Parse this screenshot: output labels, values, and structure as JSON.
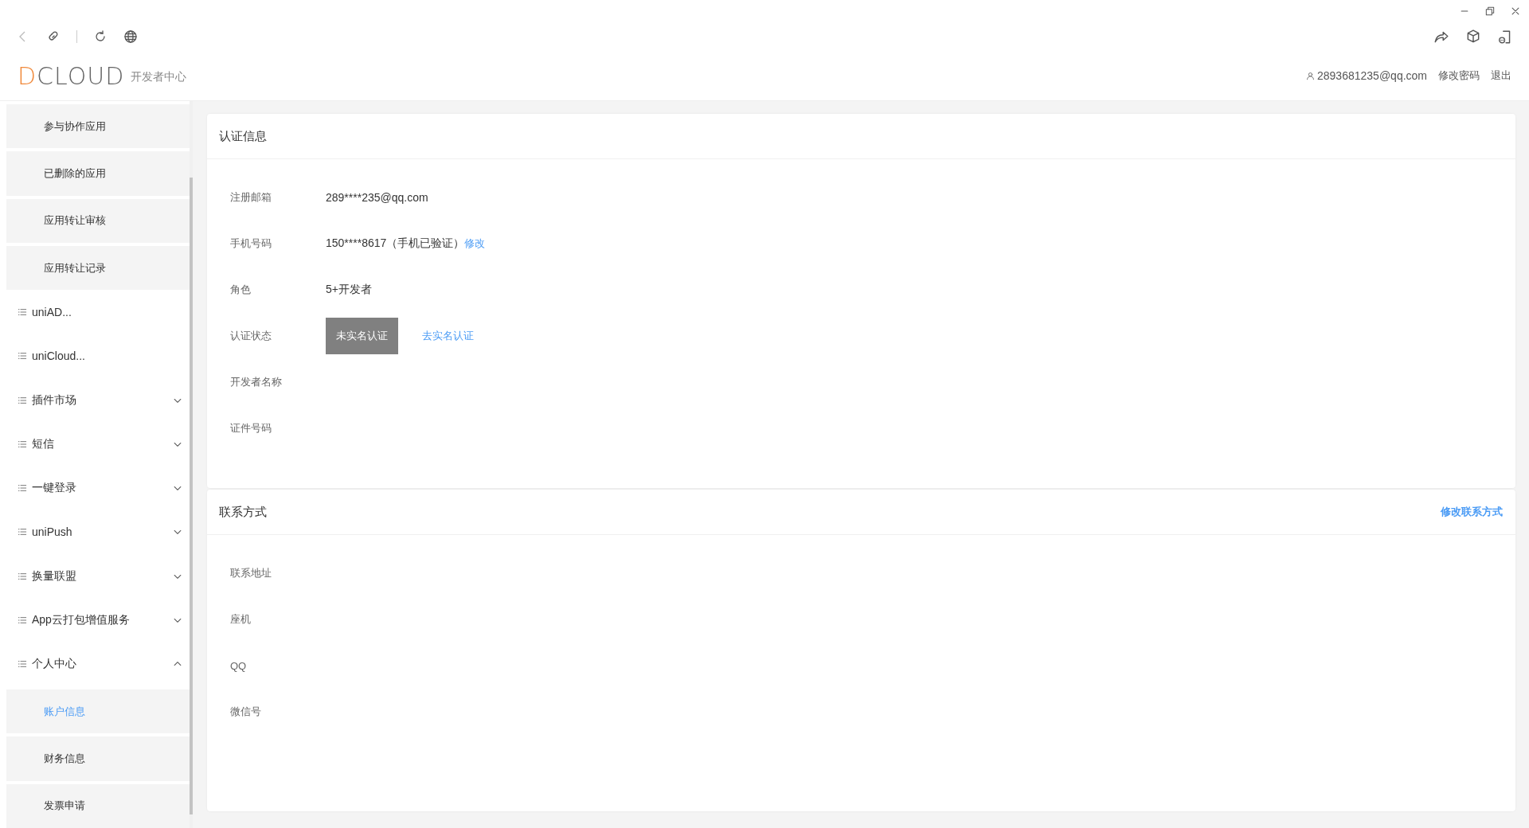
{
  "toolbar": {
    "user_email": "2893681235@qq.com",
    "links": [
      "修改密码",
      "退出"
    ]
  },
  "logo": {
    "mark": "DCLOUD",
    "subtitle": "开发者中心"
  },
  "sidebar": {
    "items": [
      {
        "kind": "sub",
        "label": "参与协作应用",
        "selected": false
      },
      {
        "kind": "sub",
        "label": "已删除的应用",
        "selected": false
      },
      {
        "kind": "sub",
        "label": "应用转让审核",
        "selected": false
      },
      {
        "kind": "sub",
        "label": "应用转让记录",
        "selected": false
      },
      {
        "kind": "link",
        "label": "uniAD..."
      },
      {
        "kind": "link",
        "label": "uniCloud..."
      },
      {
        "kind": "group",
        "label": "插件市场",
        "expanded": false
      },
      {
        "kind": "group",
        "label": "短信",
        "expanded": false
      },
      {
        "kind": "group",
        "label": "一键登录",
        "expanded": false
      },
      {
        "kind": "group",
        "label": "uniPush",
        "expanded": false
      },
      {
        "kind": "group",
        "label": "换量联盟",
        "expanded": false
      },
      {
        "kind": "group",
        "label": "App云打包增值服务",
        "expanded": false
      },
      {
        "kind": "group",
        "label": "个人中心",
        "expanded": true,
        "children": [
          {
            "label": "账户信息",
            "selected": true
          },
          {
            "label": "财务信息",
            "selected": false
          },
          {
            "label": "发票申请",
            "selected": false
          }
        ]
      }
    ]
  },
  "cards": [
    {
      "title": "认证信息",
      "rows": [
        {
          "kind": "text",
          "label": "注册邮箱",
          "value": "289****235@qq.com"
        },
        {
          "kind": "text_link",
          "label": "手机号码",
          "value": "150****8617（手机已验证）",
          "link": "修改"
        },
        {
          "kind": "text",
          "label": "角色",
          "value": "5+开发者"
        },
        {
          "kind": "badge_link",
          "label": "认证状态",
          "badge": "未实名认证",
          "link": "去实名认证"
        },
        {
          "kind": "empty",
          "label": "开发者名称"
        },
        {
          "kind": "empty",
          "label": "证件号码"
        }
      ]
    },
    {
      "title": "联系方式",
      "action": "修改联系方式",
      "rows": [
        {
          "kind": "empty",
          "label": "联系地址"
        },
        {
          "kind": "empty",
          "label": "座机"
        },
        {
          "kind": "empty",
          "label": "QQ"
        },
        {
          "kind": "empty",
          "label": "微信号"
        }
      ]
    }
  ]
}
